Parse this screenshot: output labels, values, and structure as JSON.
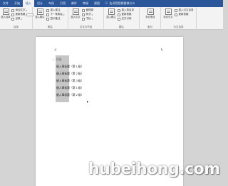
{
  "tabs": [
    {
      "label": "文件",
      "active": false
    },
    {
      "label": "开始",
      "active": true
    },
    {
      "label": "插入",
      "active": false
    },
    {
      "label": "设计",
      "active": false
    },
    {
      "label": "布局",
      "active": false
    },
    {
      "label": "引用",
      "active": false
    },
    {
      "label": "邮件",
      "active": false
    },
    {
      "label": "审阅",
      "active": false
    },
    {
      "label": "视图",
      "active": false
    }
  ],
  "tellme": {
    "icon": "lightbulb-icon",
    "label": "告诉我您想要做什么"
  },
  "ribbon": {
    "groups": [
      {
        "title": "目录",
        "big_label": "插入目录",
        "items": [
          "添加文字",
          "更新表格",
          "目录"
        ]
      },
      {
        "title": "脚注",
        "big_label": "插入脚注",
        "items": [
          "插入尾注",
          "下一条脚注",
          "显示备注"
        ]
      },
      {
        "title": "引文与书目",
        "big_label": "插入引文",
        "items": [
          "管理源",
          "样式",
          "书目"
        ]
      },
      {
        "title": "题注",
        "big_label": "插入题注",
        "items": [
          "插入表目录",
          "更新表格",
          "交叉引用"
        ]
      },
      {
        "title": "索引",
        "big_label": "标记条目",
        "items": []
      },
      {
        "title": "引文目录",
        "big_label": "标记引文",
        "items": [
          "插入引文目录",
          "更新表格"
        ]
      }
    ]
  },
  "document": {
    "first_line": "目录",
    "lines": [
      "键入章标题（第 1 级）",
      "键入章标题（第 2 级）",
      "键入章标题（第 3 级）",
      "键入章标题（第 1 级）",
      "键入章标题（第 2 级）"
    ]
  },
  "watermark": "hubeihong.com"
}
